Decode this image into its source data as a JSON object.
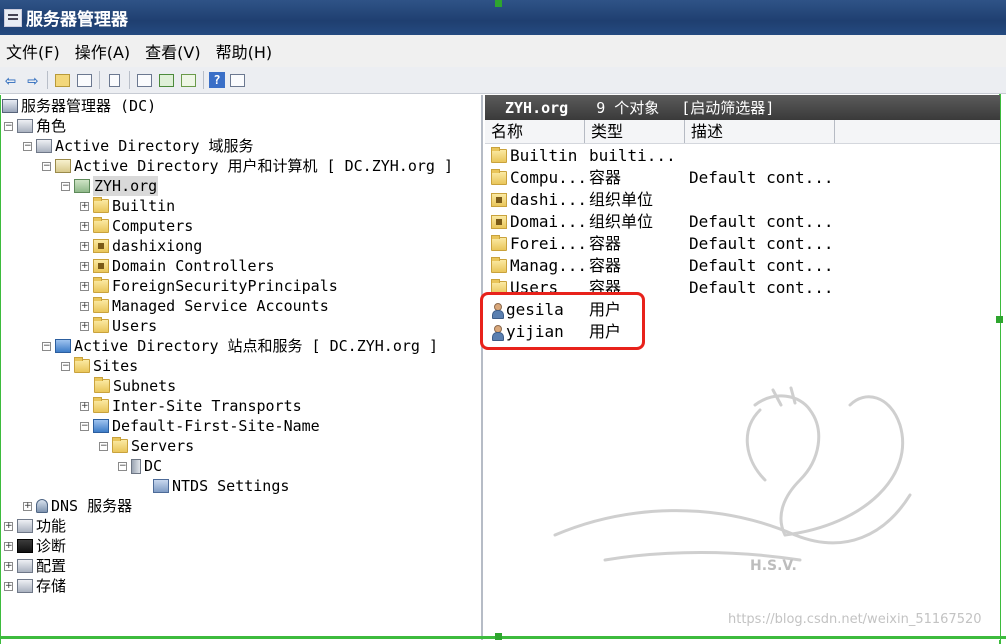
{
  "window": {
    "title": "服务器管理器"
  },
  "menu": [
    "文件(F)",
    "操作(A)",
    "查看(V)",
    "帮助(H)"
  ],
  "toolbar": {
    "icons": [
      "back-arrow-icon",
      "forward-arrow-icon",
      "up-folder-icon",
      "show-hide-tree-icon",
      "clipboard-icon",
      "properties-icon",
      "refresh-icon",
      "export-list-icon",
      "help-icon",
      "view-icon"
    ],
    "help_glyph": "?"
  },
  "tree": {
    "root": "服务器管理器 (DC)",
    "roles": "角色",
    "ad_ds": "Active Directory 域服务",
    "ad_uc": "Active Directory 用户和计算机 [ DC.ZYH.org ]",
    "domain": "ZYH.org",
    "domain_children": [
      "Builtin",
      "Computers",
      "dashixiong",
      "Domain Controllers",
      "ForeignSecurityPrincipals",
      "Managed Service Accounts",
      "Users"
    ],
    "ad_sites": "Active Directory 站点和服务 [ DC.ZYH.org ]",
    "sites": "Sites",
    "subnets": "Subnets",
    "inter_site": "Inter-Site Transports",
    "default_site": "Default-First-Site-Name",
    "servers": "Servers",
    "dc": "DC",
    "ntds": "NTDS Settings",
    "dns": "DNS 服务器",
    "features": "功能",
    "diagnostics": "诊断",
    "configuration": "配置",
    "storage": "存储"
  },
  "right": {
    "header_name": "ZYH.org",
    "header_count": "9 个对象",
    "header_filter": "[启动筛选器]",
    "columns": [
      "名称",
      "类型",
      "描述"
    ],
    "rows": [
      {
        "name": "Builtin",
        "type": "builti...",
        "desc": "",
        "icon": "folder-icon"
      },
      {
        "name": "Compu...",
        "type": "容器",
        "desc": "Default cont...",
        "icon": "folder-icon"
      },
      {
        "name": "dashi...",
        "type": "组织单位",
        "desc": "",
        "icon": "ou-icon"
      },
      {
        "name": "Domai...",
        "type": "组织单位",
        "desc": "Default cont...",
        "icon": "ou-icon"
      },
      {
        "name": "Forei...",
        "type": "容器",
        "desc": "Default cont...",
        "icon": "folder-icon"
      },
      {
        "name": "Manag...",
        "type": "容器",
        "desc": "Default cont...",
        "icon": "folder-icon"
      },
      {
        "name": "Users",
        "type": "容器",
        "desc": "Default cont...",
        "icon": "folder-icon"
      },
      {
        "name": "gesila",
        "type": "用户",
        "desc": "",
        "icon": "user-icon"
      },
      {
        "name": "yijian",
        "type": "用户",
        "desc": "",
        "icon": "user-icon"
      }
    ]
  },
  "watermark": {
    "logo_text": "H.S.V.",
    "url": "https://blog.csdn.net/weixin_51167520"
  },
  "colors": {
    "highlight": "#e8221b",
    "frame": "#3dbb3d",
    "title_bar": "#1f3f70"
  }
}
